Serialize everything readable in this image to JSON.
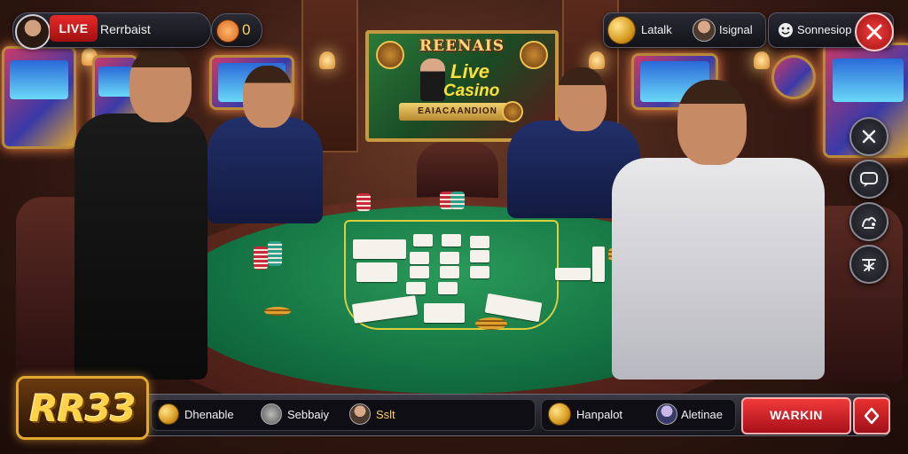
{
  "top_left": {
    "live_label": "LIVE",
    "player_name": "Rerrbaist",
    "coin_count": "0"
  },
  "top_right": {
    "item1_label": "Latalk",
    "item2_label": "Isignal",
    "option_label": "Sonnesiop"
  },
  "poster": {
    "title": "REENAIS",
    "line1": "Live",
    "line2": "Casino",
    "banner": "EAIACAANDION"
  },
  "logo": {
    "text": "RR33"
  },
  "bottom_bar": {
    "item1_label": "Dhenable",
    "item2_label": "Sebbaiy",
    "item3_label": "Sslt",
    "item4_label": "Hanpalot",
    "item5_label": "Aletinae",
    "cta_label": "WARKIN"
  },
  "side_buttons": [
    "close-icon",
    "chat-icon",
    "gesture-icon",
    "signal-icon"
  ],
  "colors": {
    "felt": "#127040",
    "accent_red": "#e82a2a",
    "gold": "#e0a830"
  }
}
